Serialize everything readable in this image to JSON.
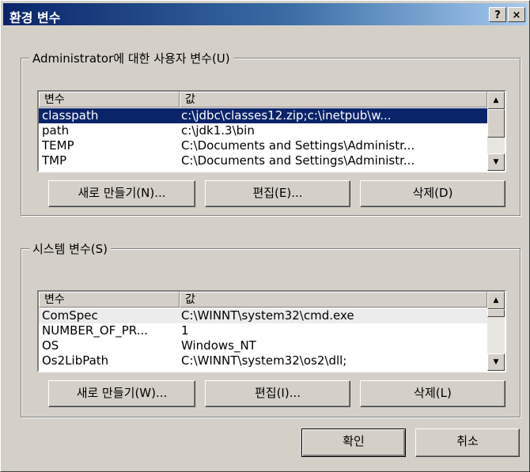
{
  "window": {
    "title": "환경 변수",
    "help_label": "?",
    "close_label": "×"
  },
  "user_vars": {
    "group_title": "Administrator에 대한 사용자 변수(U)",
    "col_name": "변수",
    "col_value": "값",
    "rows": [
      {
        "name": "classpath",
        "value": "c:\\jdbc\\classes12.zip;c:\\inetpub\\w...",
        "selected": true
      },
      {
        "name": "path",
        "value": "c:\\jdk1.3\\bin",
        "selected": false
      },
      {
        "name": "TEMP",
        "value": "C:\\Documents and Settings\\Administr...",
        "selected": false
      },
      {
        "name": "TMP",
        "value": "C:\\Documents and Settings\\Administr...",
        "selected": false
      }
    ],
    "new_label": "새로 만들기(N)...",
    "edit_label": "편집(E)...",
    "delete_label": "삭제(D)"
  },
  "system_vars": {
    "group_title": "시스템 변수(S)",
    "col_name": "변수",
    "col_value": "값",
    "rows": [
      {
        "name": "ComSpec",
        "value": "C:\\WINNT\\system32\\cmd.exe",
        "selected": true
      },
      {
        "name": "NUMBER_OF_PR...",
        "value": "1",
        "selected": false
      },
      {
        "name": "OS",
        "value": "Windows_NT",
        "selected": false
      },
      {
        "name": "Os2LibPath",
        "value": "C:\\WINNT\\system32\\os2\\dll;",
        "selected": false
      }
    ],
    "new_label": "새로 만들기(W)...",
    "edit_label": "편집(I)...",
    "delete_label": "삭제(L)"
  },
  "footer": {
    "ok_label": "확인",
    "cancel_label": "취소"
  },
  "icons": {
    "scroll_up": "triangle-up",
    "scroll_down": "triangle-down"
  }
}
